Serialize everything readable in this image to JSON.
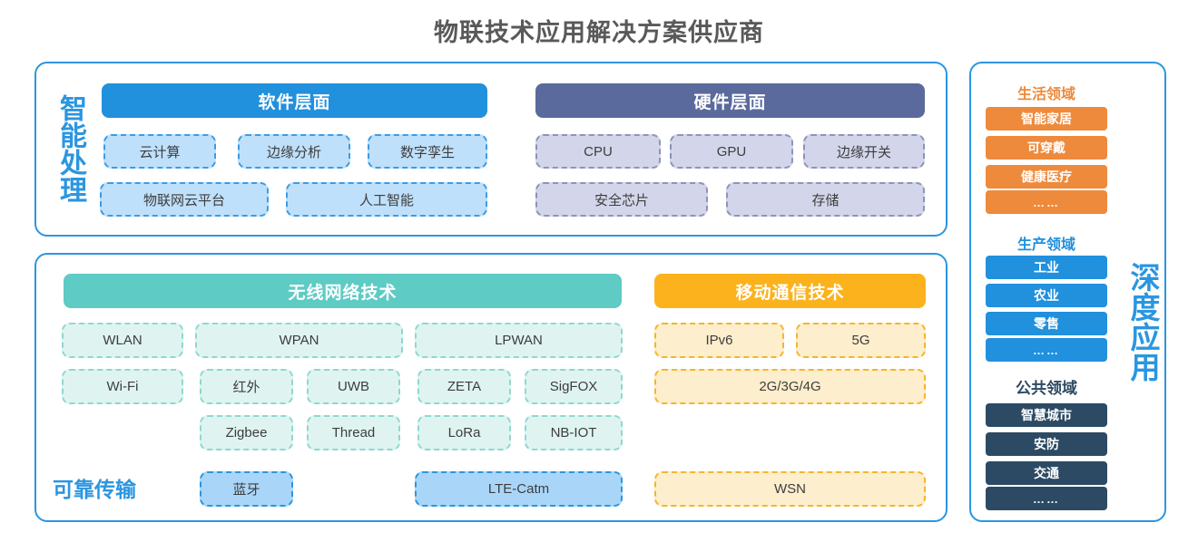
{
  "title": "物联技术应用解决方案供应商",
  "colors": {
    "card_border": "#2b96e0",
    "software_bar": "#2190dd",
    "hardware_bar": "#5a6a9c",
    "wireless_bar": "#5ecbc4",
    "mobile_bar": "#fbb21c",
    "life_domain": "#ee8a3c",
    "production_domain": "#2190dd",
    "public_domain": "#2c4a63",
    "title_text": "#595959",
    "accent_blue": "#2b96e0"
  },
  "left_labels": {
    "smart_processing": "智能处理",
    "reliable_transport": "可靠传输"
  },
  "right_label": {
    "deep_application": "深度应用"
  },
  "layers": {
    "software": {
      "header": "软件层面",
      "row1": [
        "云计算",
        "边缘分析",
        "数字孪生"
      ],
      "row2": [
        "物联网云平台",
        "人工智能"
      ]
    },
    "hardware": {
      "header": "硬件层面",
      "row1": [
        "CPU",
        "GPU",
        "边缘开关"
      ],
      "row2": [
        "安全芯片",
        "存储"
      ]
    },
    "wireless": {
      "header": "无线网络技术",
      "row1": [
        "WLAN",
        "WPAN",
        "LPWAN"
      ],
      "row2": [
        "Wi-Fi",
        "红外",
        "UWB",
        "ZETA",
        "SigFOX"
      ],
      "row3": [
        "Zigbee",
        "Thread",
        "LoRa",
        "NB-IOT"
      ],
      "row4": [
        "蓝牙",
        "LTE-Catm"
      ]
    },
    "mobile": {
      "header": "移动通信技术",
      "row1": [
        "IPv6",
        "5G"
      ],
      "row2": [
        "2G/3G/4G"
      ],
      "row3": [
        "WSN"
      ]
    }
  },
  "domains": [
    {
      "name": "生活领域",
      "color": "#ee8a3c",
      "items": [
        "智能家居",
        "可穿戴",
        "健康医疗",
        "……"
      ]
    },
    {
      "name": "生产领域",
      "color": "#2190dd",
      "items": [
        "工业",
        "农业",
        "零售",
        "……"
      ]
    },
    {
      "name": "公共领域",
      "color": "#2c4a63",
      "items": [
        "智慧城市",
        "安防",
        "交通",
        "……"
      ]
    }
  ]
}
